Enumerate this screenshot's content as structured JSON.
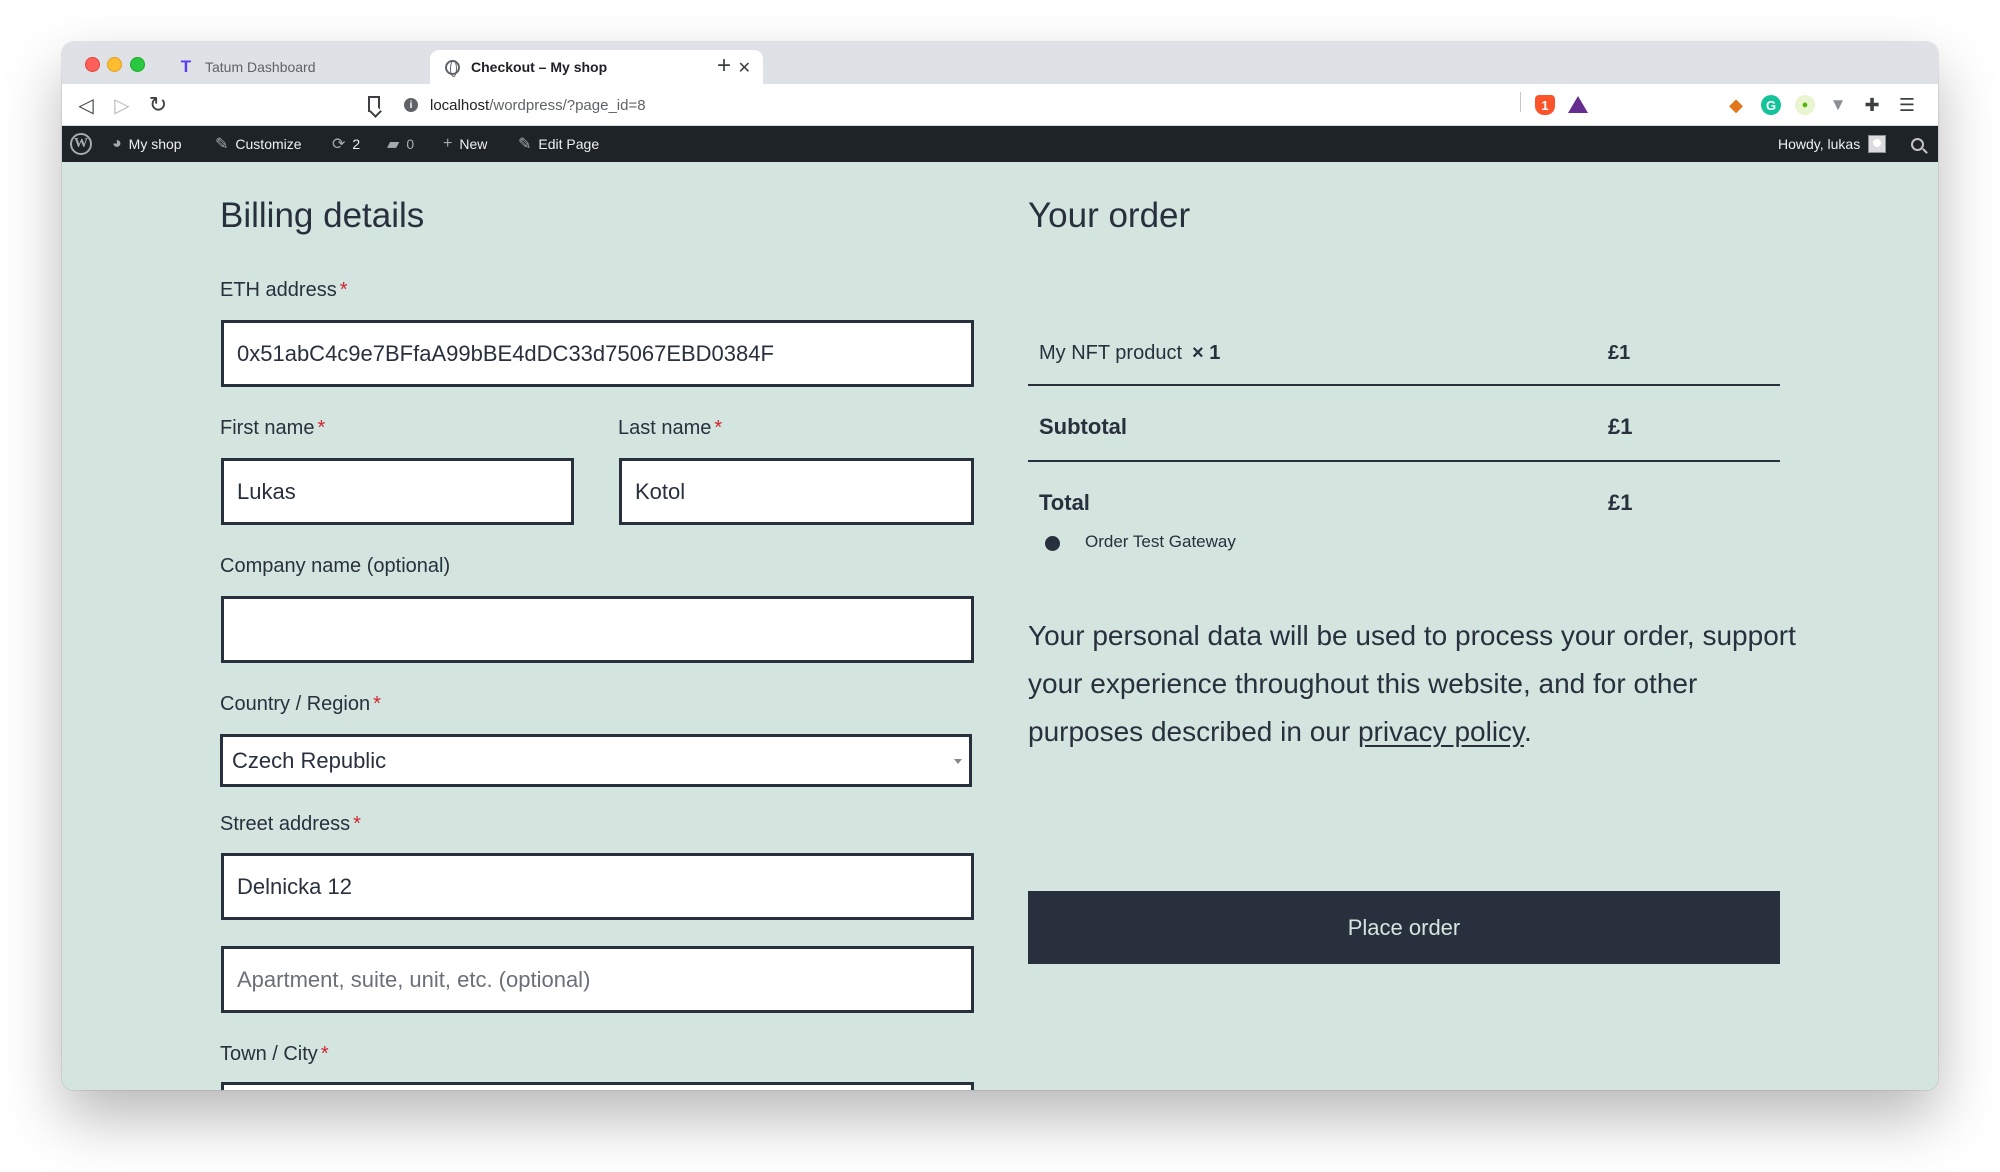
{
  "browser": {
    "tabs": [
      {
        "title": "Tatum Dashboard",
        "favicon": "tatum-icon"
      },
      {
        "title": "Checkout – My shop",
        "favicon": "globe-icon"
      }
    ],
    "close_glyph": "✕",
    "newtab_glyph": "+",
    "url_host": "localhost",
    "url_rest": "/wordpress/?page_id=8",
    "brave_badge": "1"
  },
  "adminbar": {
    "site": "My shop",
    "customize": "Customize",
    "updates_count": "2",
    "comments_count": "0",
    "new": "New",
    "edit_page": "Edit Page",
    "howdy": "Howdy, lukas"
  },
  "billing": {
    "heading": "Billing details",
    "eth_label": "ETH address",
    "eth_value": "0x51abC4c9e7BFfaA99bBE4dDC33d75067EBD0384F",
    "first_label": "First name",
    "first_value": "Lukas",
    "last_label": "Last name",
    "last_value": "Kotol",
    "company_label": "Company name (optional)",
    "company_value": "",
    "country_label": "Country / Region",
    "country_value": "Czech Republic",
    "street_label": "Street address",
    "street_value": "Delnicka 12",
    "apt_placeholder": "Apartment, suite, unit, etc. (optional)",
    "city_label": "Town / City",
    "required_mark": "*"
  },
  "order": {
    "heading": "Your order",
    "product_name": "My NFT product",
    "product_qty": "× 1",
    "product_price": "£1",
    "subtotal_label": "Subtotal",
    "subtotal_value": "£1",
    "total_label": "Total",
    "total_value": "£1",
    "gateway": "Order Test Gateway",
    "privacy_text": "Your personal data will be used to process your order, support your experience throughout this website, and for other purposes described in our ",
    "privacy_link": "privacy policy",
    "privacy_end": ".",
    "place_order": "Place order"
  },
  "colors": {
    "page_bg": "#d4e5df",
    "text": "#28303d",
    "adminbar_bg": "#1d2327",
    "required": "#d1242f"
  }
}
